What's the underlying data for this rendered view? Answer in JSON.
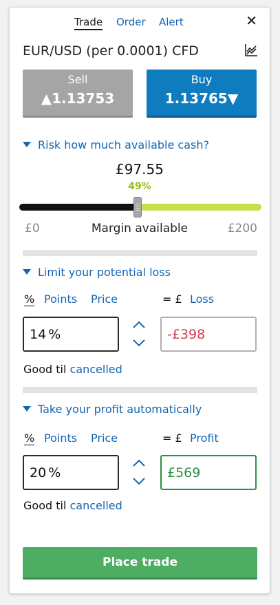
{
  "tabs": [
    {
      "label": "Trade",
      "active": true
    },
    {
      "label": "Order",
      "active": false
    },
    {
      "label": "Alert",
      "active": false
    }
  ],
  "close_glyph": "✕",
  "instrument": "EUR/USD (per 0.0001) CFD",
  "sell": {
    "label": "Sell",
    "price": "▲1.13753",
    "color": "#a5a5a5"
  },
  "buy": {
    "label": "Buy",
    "price": "1.13765▼",
    "color": "#0f7cbf"
  },
  "risk": {
    "title": "Risk how much available cash?",
    "amount": "£97.55",
    "percent": "49%",
    "fraction": 0.49,
    "min": "£0",
    "max": "£200",
    "center_label": "Margin available"
  },
  "loss": {
    "title": "Limit your potential loss",
    "options": [
      "%",
      "Points",
      "Price"
    ],
    "eq_label": "= £",
    "target_label": "Loss",
    "value": "14",
    "unit": "%",
    "amount": "-£398",
    "good_til": "Good til",
    "good_til_link": "cancelled"
  },
  "profit": {
    "title": "Take your profit automatically",
    "options": [
      "%",
      "Points",
      "Price"
    ],
    "eq_label": "= £",
    "target_label": "Profit",
    "value": "20",
    "unit": "%",
    "amount": "£569",
    "good_til": "Good til",
    "good_til_link": "cancelled"
  },
  "place_button": "Place trade",
  "colors": {
    "accent": "#1565b4",
    "slider_green": "#c3e24a",
    "percent_green": "#93c01f",
    "loss_red": "#d63b4a",
    "profit_green": "#2f8f45",
    "place_green": "#4dad63"
  },
  "icons": [
    "close-icon",
    "chart-icon",
    "caret-down-icon",
    "stepper-up-icon",
    "stepper-down-icon"
  ]
}
